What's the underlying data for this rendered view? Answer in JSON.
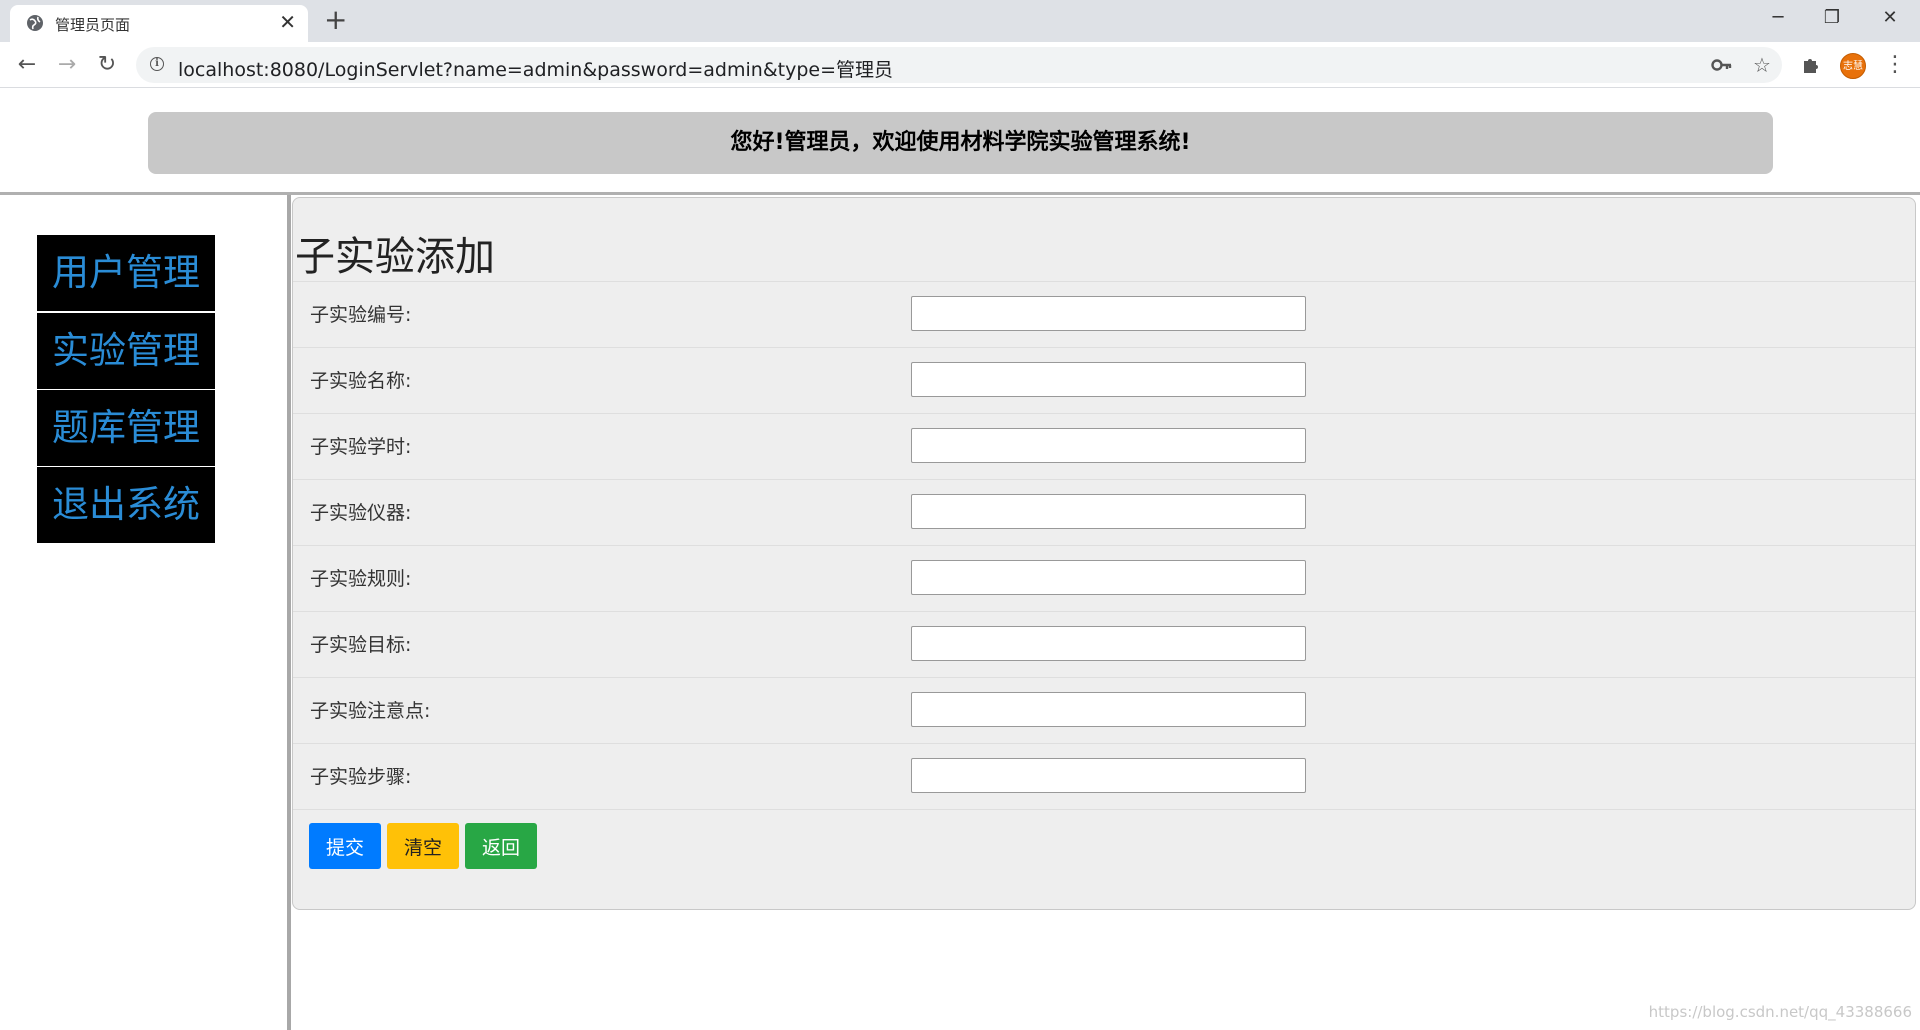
{
  "browser": {
    "tab_title": "管理员页面",
    "url": "localhost:8080/LoginServlet?name=admin&password=admin&type=管理员",
    "profile_initials": "志慧"
  },
  "header": {
    "banner_text": "您好!管理员，欢迎使用材料学院实验管理系统!"
  },
  "sidebar": {
    "items": [
      {
        "label": "用户管理"
      },
      {
        "label": "实验管理"
      },
      {
        "label": "题库管理"
      },
      {
        "label": "退出系统"
      }
    ]
  },
  "form": {
    "title": "子实验添加",
    "fields": [
      {
        "label": "子实验编号:",
        "value": ""
      },
      {
        "label": "子实验名称:",
        "value": ""
      },
      {
        "label": "子实验学时:",
        "value": ""
      },
      {
        "label": "子实验仪器:",
        "value": ""
      },
      {
        "label": "子实验规则:",
        "value": ""
      },
      {
        "label": "子实验目标:",
        "value": ""
      },
      {
        "label": "子实验注意点:",
        "value": ""
      },
      {
        "label": "子实验步骤:",
        "value": ""
      }
    ],
    "buttons": {
      "submit": "提交",
      "clear": "清空",
      "back": "返回"
    }
  },
  "watermark": "https://blog.csdn.net/qq_43388666",
  "colors": {
    "banner_bg": "#c8c8c8",
    "sidebar_item_bg": "#000000",
    "sidebar_item_text": "#2a8cd6",
    "panel_bg": "#eeeeee",
    "submit": "#007bff",
    "clear": "#ffc107",
    "back": "#28a745"
  }
}
